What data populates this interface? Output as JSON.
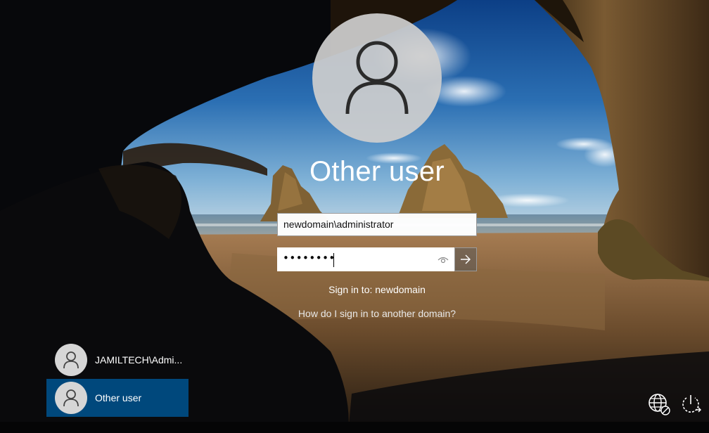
{
  "login": {
    "title": "Other user",
    "username_value": "newdomain\\administrator",
    "password_mask": "••••••••",
    "sign_in_to": "Sign in to: newdomain",
    "help_link": "How do I sign in to another domain?"
  },
  "user_list": [
    {
      "label": "JAMILTECH\\Admi...",
      "selected": false
    },
    {
      "label": "Other user",
      "selected": true
    }
  ],
  "icons": {
    "avatar": "user-silhouette-icon",
    "reveal": "eye-icon",
    "submit": "arrow-right-icon",
    "network": "network-globe-icon",
    "power": "power-icon"
  },
  "colors": {
    "selected_tile": "#00487c",
    "avatar_circle": "#cecece",
    "text": "#ffffff"
  }
}
